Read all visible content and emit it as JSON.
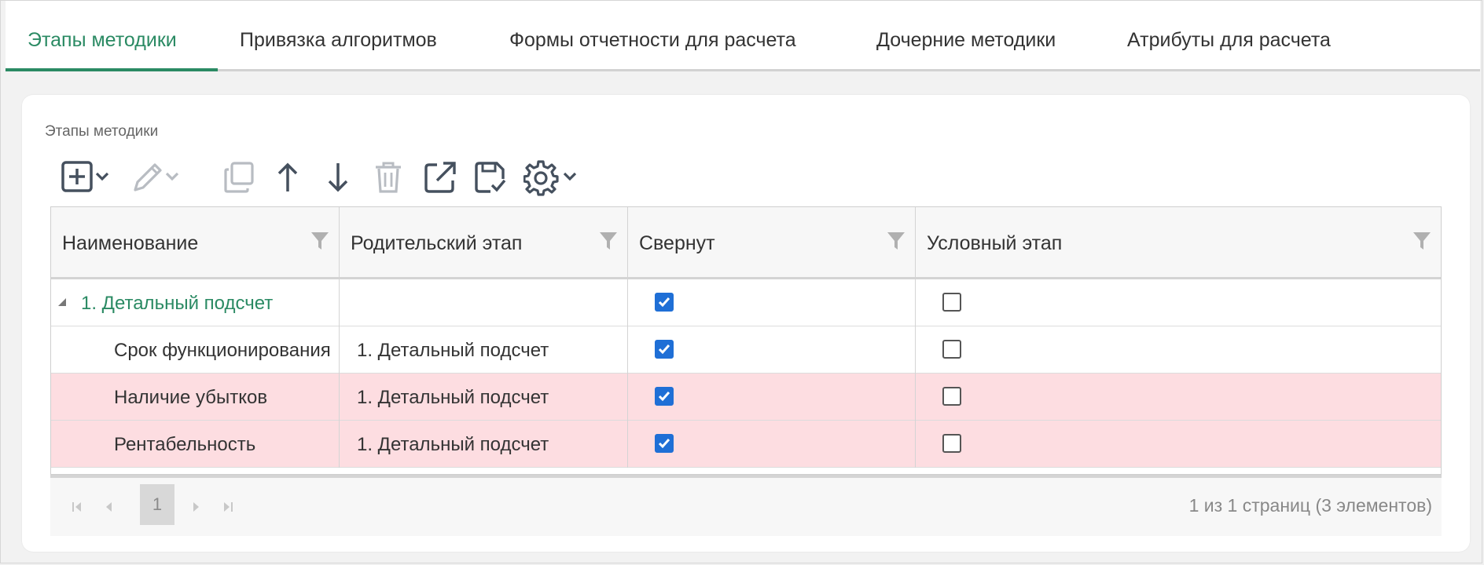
{
  "tabs": [
    {
      "label": "Этапы методики",
      "active": true
    },
    {
      "label": "Привязка алгоритмов",
      "active": false
    },
    {
      "label": "Формы отчетности для расчета",
      "active": false
    },
    {
      "label": "Дочерние методики",
      "active": false
    },
    {
      "label": "Атрибуты для расчета",
      "active": false
    }
  ],
  "section": {
    "title": "Этапы методики"
  },
  "toolbar": {
    "icons": [
      "add-icon",
      "edit-icon",
      "copy-icon",
      "move-up-icon",
      "move-down-icon",
      "delete-icon",
      "open-external-icon",
      "save-icon",
      "settings-icon"
    ]
  },
  "grid": {
    "columns": [
      "Наименование",
      "Родительский этап",
      "Свернут",
      "Условный этап"
    ],
    "rows": [
      {
        "name": "1. Детальный подсчет",
        "parent": "",
        "collapsed": true,
        "conditional": false,
        "group": true,
        "error": false
      },
      {
        "name": "Срок функционирования",
        "parent": "1. Детальный подсчет",
        "collapsed": true,
        "conditional": false,
        "group": false,
        "error": false
      },
      {
        "name": "Наличие убытков",
        "parent": "1. Детальный подсчет",
        "collapsed": true,
        "conditional": false,
        "group": false,
        "error": true
      },
      {
        "name": "Рентабельность",
        "parent": "1. Детальный подсчет",
        "collapsed": true,
        "conditional": false,
        "group": false,
        "error": true
      }
    ]
  },
  "pager": {
    "current_page": "1",
    "info": "1 из 1 страниц (3 элементов)"
  },
  "colors": {
    "accent": "#2a8a63",
    "checkbox": "#1f6fd6",
    "error_row": "#fddde1"
  }
}
